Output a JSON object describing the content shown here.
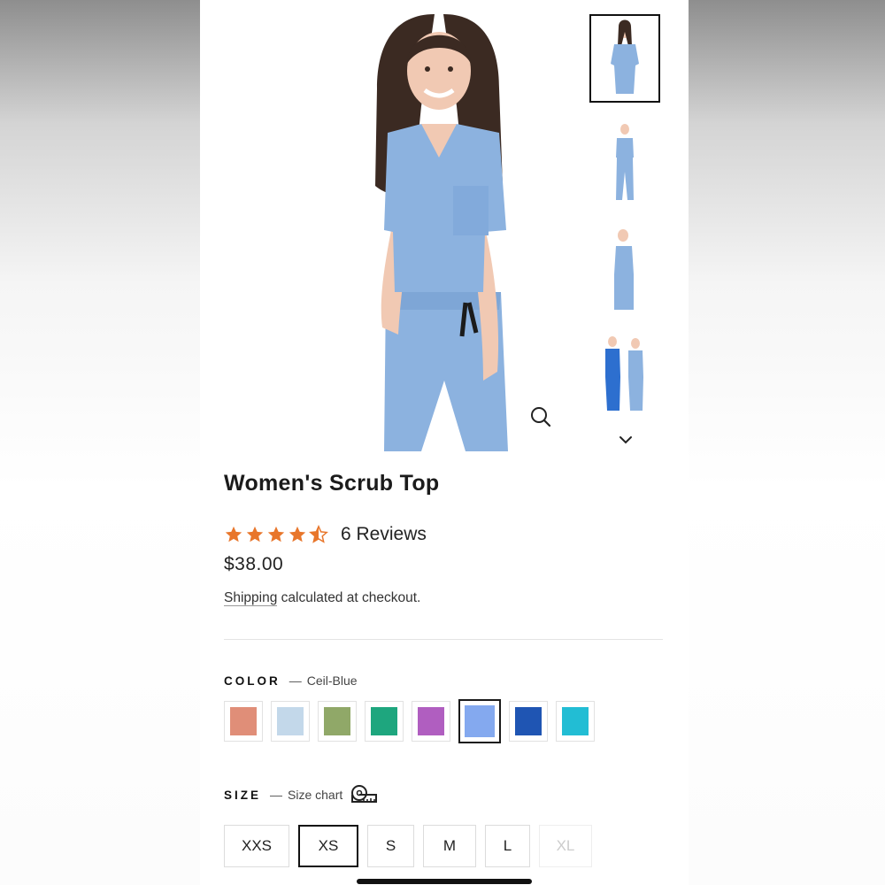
{
  "product": {
    "title": "Women's Scrub Top",
    "rating": 4.5,
    "reviews_label": "6 Reviews",
    "price": "$38.00",
    "shipping_link": "Shipping",
    "shipping_suffix": " calculated at checkout."
  },
  "gallery": {
    "thumbnail_count": 4,
    "active_thumbnail": 0
  },
  "color": {
    "label": "COLOR",
    "selected_name": "Ceil-Blue",
    "swatches": [
      "#e08e78",
      "#c3d8ea",
      "#90a868",
      "#1ea67e",
      "#b05ec0",
      "#84a9ef",
      "#1f55b3",
      "#22bdd4"
    ],
    "selected_index": 5
  },
  "size": {
    "label": "SIZE",
    "chart_label": "Size chart",
    "options": [
      "XXS",
      "XS",
      "S",
      "M",
      "L",
      "XL"
    ],
    "selected": "XS",
    "unavailable": [
      "XL"
    ]
  },
  "colors": {
    "star": "#e8762b",
    "scrub_blue": "#8cb2df"
  }
}
